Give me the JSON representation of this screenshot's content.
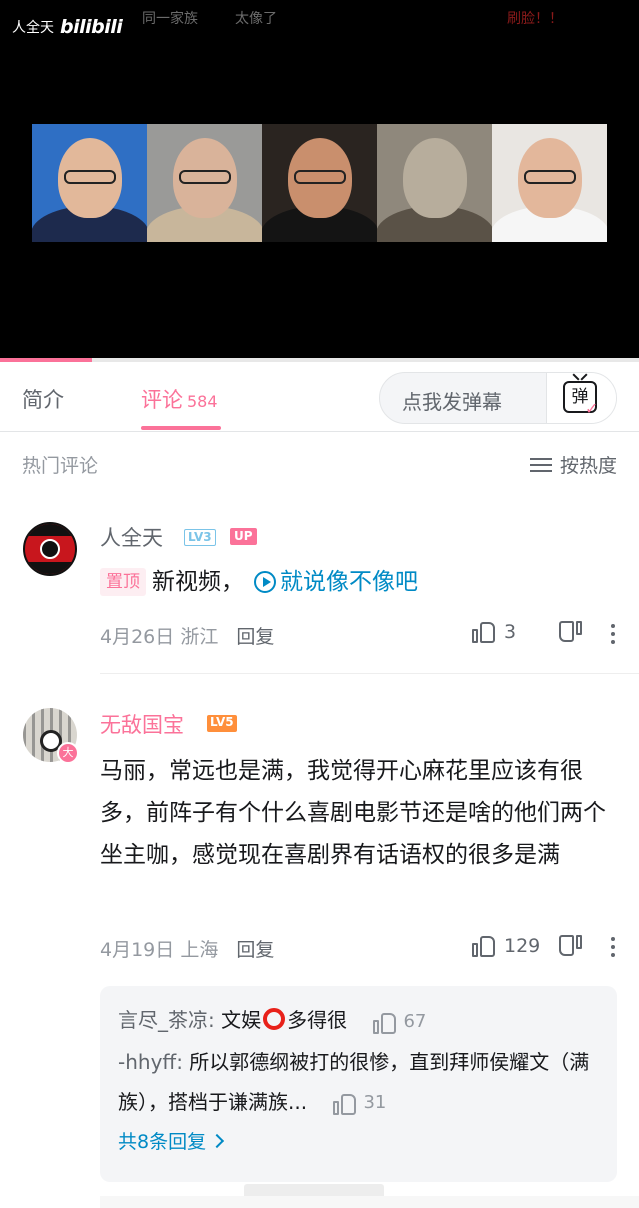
{
  "video": {
    "watermark_name": "人全天",
    "watermark_logo": "bilibili",
    "ticker": [
      "同一家族",
      "太像了",
      "刷脸！！"
    ],
    "progress_fraction": 0.144
  },
  "tabs": {
    "intro": "简介",
    "comments": "评论",
    "comments_count": "584",
    "danmaku_placeholder": "点我发弹幕",
    "danmaku_button": "弹"
  },
  "section": {
    "title": "热门评论",
    "sort_label": "按热度"
  },
  "comments": [
    {
      "user": "人全天",
      "level": "LV3",
      "badge": "UP",
      "pin_label": "置顶",
      "text": "新视频，",
      "link_text": "就说像不像吧",
      "date": "4月26日",
      "location": "浙江",
      "reply_label": "回复",
      "likes": "3"
    },
    {
      "user": "无敌国宝",
      "level": "LV5",
      "vip_badge": "大",
      "text": "马丽，常远也是满，我觉得开心麻花里应该有很多，前阵子有个什么喜剧电影节还是啥的他们两个坐主咖，感觉现在喜剧界有话语权的很多是满",
      "date": "4月19日",
      "location": "上海",
      "reply_label": "回复",
      "likes": "129",
      "replies": [
        {
          "user": "言尽_茶凉",
          "text_before": "文娱",
          "text_after": "多得很",
          "likes": "67"
        },
        {
          "user": "-hhyff",
          "text": "所以郭德纲被打的很惨，直到拜师侯耀文（满族），搭档于谦满族...",
          "likes": "31"
        }
      ],
      "more_replies": "共8条回复"
    }
  ],
  "colors": {
    "accent_pink": "#fb7299",
    "link_blue": "#008ac5",
    "text_gray": "#9499a0"
  }
}
